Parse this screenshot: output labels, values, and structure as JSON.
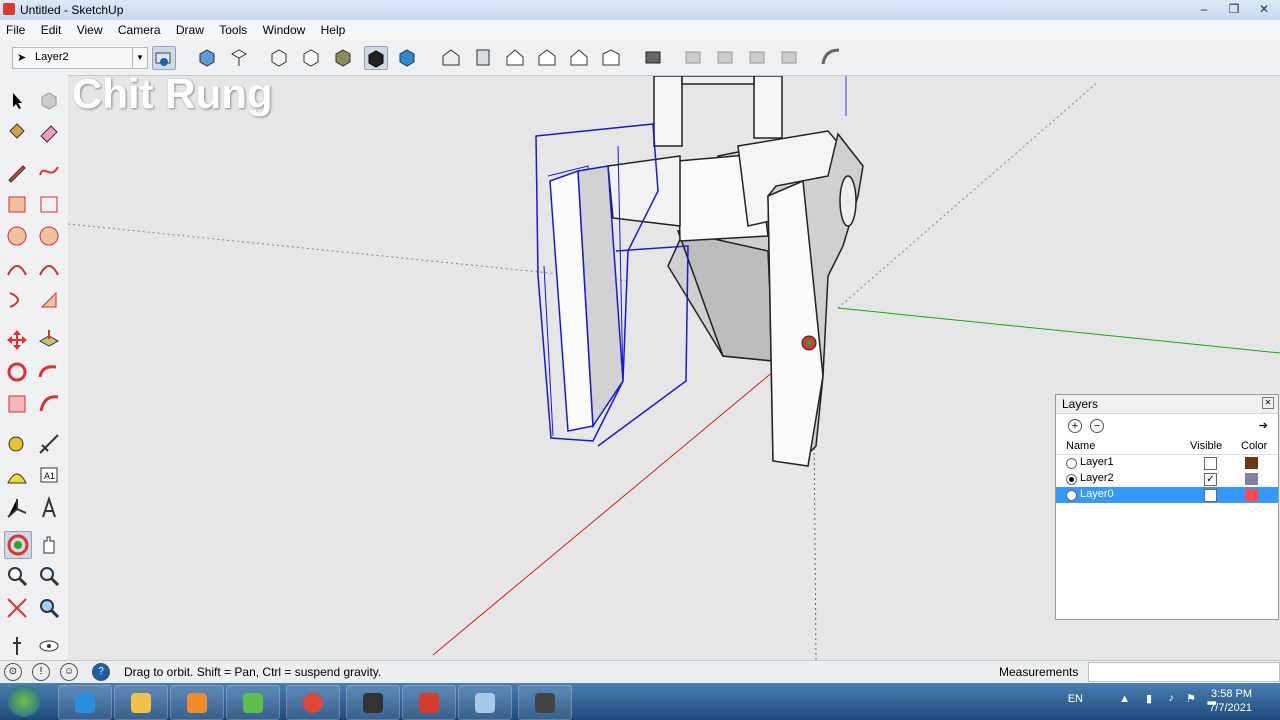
{
  "window": {
    "title": "Untitled - SketchUp",
    "controls": [
      "minimize-icon",
      "restore-icon",
      "close-icon"
    ]
  },
  "menu": [
    "File",
    "Edit",
    "View",
    "Camera",
    "Draw",
    "Tools",
    "Window",
    "Help"
  ],
  "toolbar": {
    "current_layer": "Layer2"
  },
  "watermark": "Chit Rung",
  "status": {
    "message": "Drag to orbit.  Shift = Pan, Ctrl = suspend gravity.",
    "measurements_label": "Measurements",
    "measurements_value": ""
  },
  "layers_panel": {
    "title": "Layers",
    "columns": {
      "name": "Name",
      "visible": "Visible",
      "color": "Color"
    },
    "rows": [
      {
        "name": "Layer1",
        "active": false,
        "visible": false,
        "color": "#6b3a12",
        "selected": false
      },
      {
        "name": "Layer2",
        "active": true,
        "visible": true,
        "color": "#8080a0",
        "selected": false
      },
      {
        "name": "Layer0",
        "active": false,
        "visible": false,
        "color": "#ff4a4a",
        "selected": true
      }
    ]
  },
  "tray": {
    "language": "EN",
    "time": "3:58 PM",
    "date": "7/7/2021"
  },
  "colors": {
    "selection_blue": "#1a1ad6",
    "axis_red": "#cc2222",
    "axis_green": "#11aa11",
    "viewport_bg": "#e6e6e6"
  }
}
